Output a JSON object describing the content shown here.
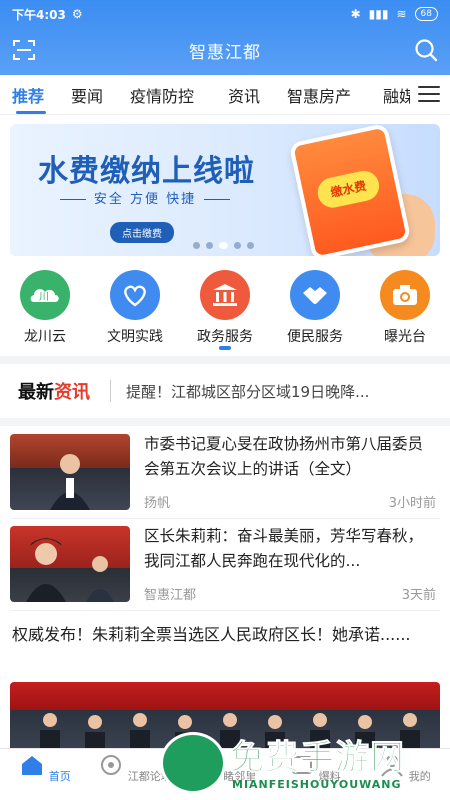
{
  "status_bar": {
    "time": "下午4:03",
    "battery": "68"
  },
  "header": {
    "title": "智惠江都"
  },
  "tabs": [
    "推荐",
    "要闻",
    "疫情防控",
    "资讯",
    "智惠房产",
    "融媒"
  ],
  "banner": {
    "headline": "水费缴纳上线啦",
    "subtitle": "安全 方便 快捷",
    "cta": "点击缴费",
    "phone_label": "缴水费",
    "slides": 5,
    "active_slide": 3
  },
  "quick_links": [
    {
      "label": "龙川云",
      "icon": "cloud-logo-icon",
      "color": "#39b36b"
    },
    {
      "label": "文明实践",
      "icon": "heart-hands-icon",
      "color": "#3f8bef"
    },
    {
      "label": "政务服务",
      "icon": "government-building-icon",
      "color": "#f05a3c"
    },
    {
      "label": "便民服务",
      "icon": "handshake-icon",
      "color": "#3f8bef"
    },
    {
      "label": "曝光台",
      "icon": "camera-icon",
      "color": "#f58a1f"
    }
  ],
  "ticker": {
    "brand_a": "最新",
    "brand_b": "资讯",
    "text": "提醒！江都城区部分区域19日晚降..."
  },
  "news": [
    {
      "title": "市委书记夏心旻在政协扬州市第八届委员会第五次会议上的讲话（全文）",
      "source": "扬帆",
      "time": "3小时前"
    },
    {
      "title": "区长朱莉莉：奋斗最美丽，芳华写春秋，我同江都人民奔跑在现代化的...",
      "source": "智惠江都",
      "time": "3天前"
    }
  ],
  "featured": {
    "title": "权威发布！朱莉莉全票当选区人民政府区长！她承诺......"
  },
  "bottom_nav": [
    "首页",
    "江都论坛",
    "睹邻里",
    "爆料",
    "我的"
  ],
  "watermark": {
    "text": "免费手游网",
    "sub": "MIANFEISHOUYOUWANG"
  },
  "colors": {
    "accent": "#2f7fe6",
    "header": "#3b8df2"
  }
}
